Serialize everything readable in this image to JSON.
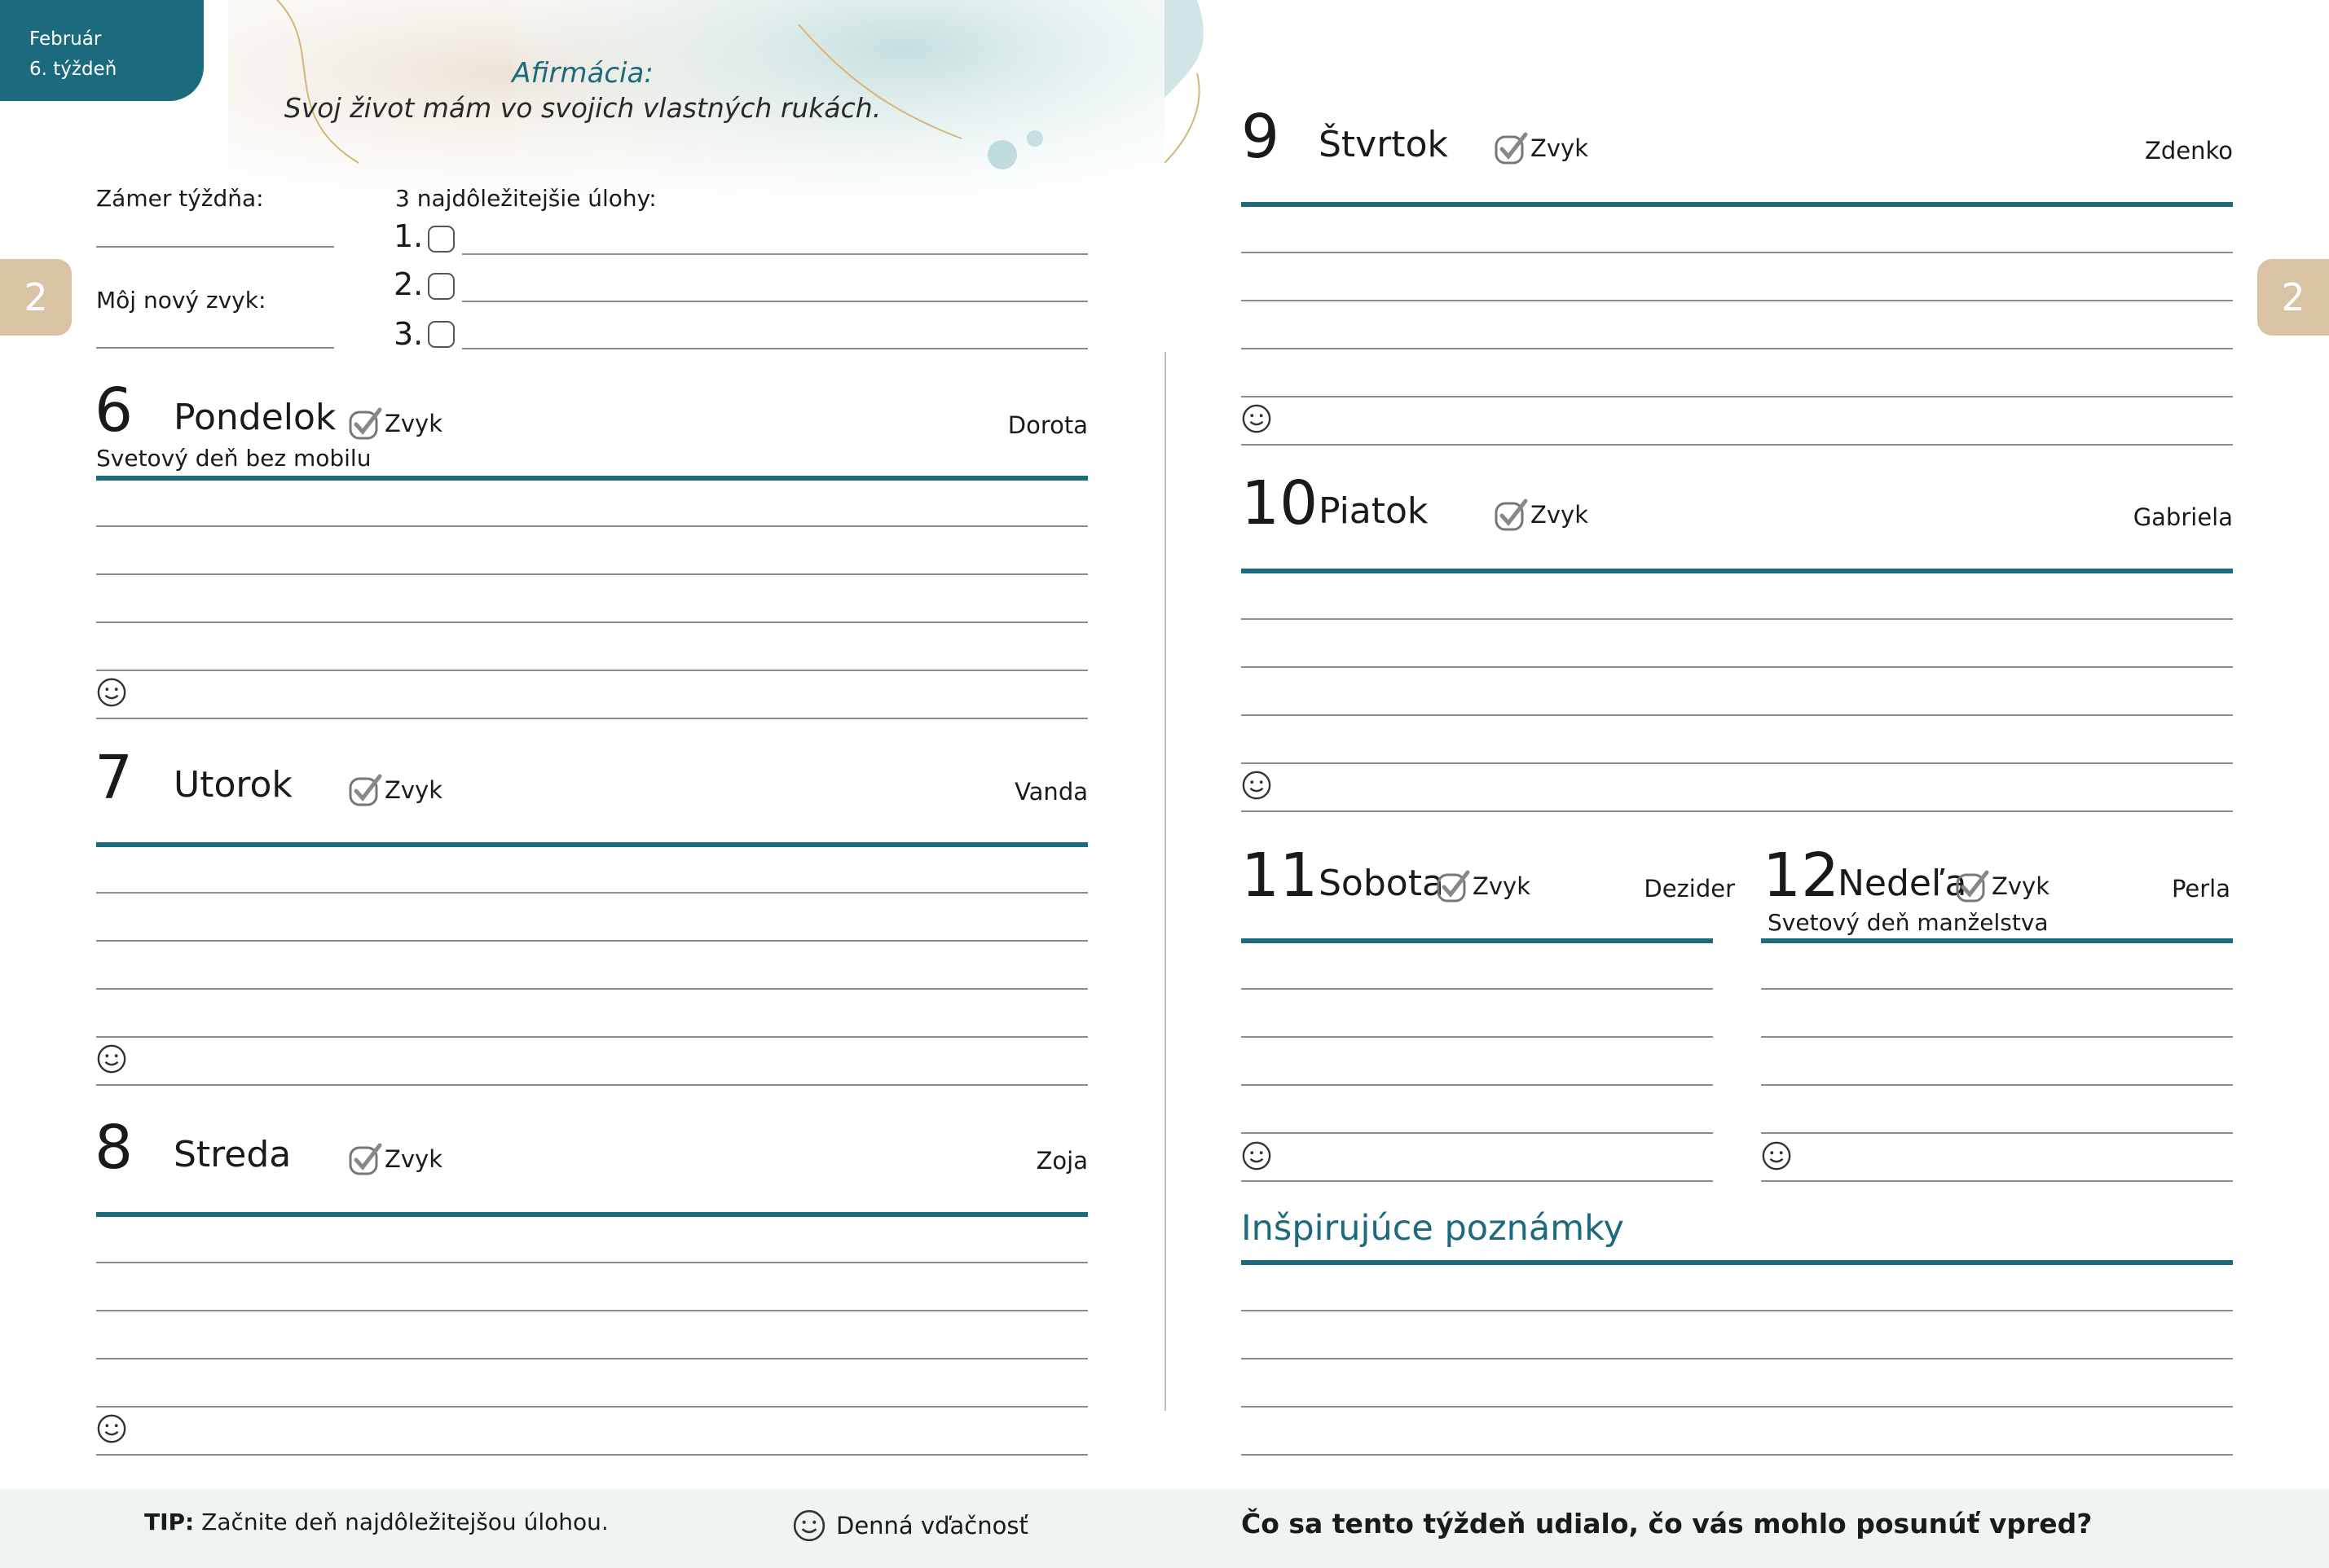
{
  "header": {
    "month": "Február",
    "week": "6. týždeň",
    "tab_number": "2"
  },
  "affirmation": {
    "title": "Afirmácia:",
    "text": "Svoj život mám vo svojich vlastných rukách."
  },
  "planning": {
    "intent_label": "Zámer týždňa:",
    "habit_label": "Môj nový zvyk:",
    "tasks_label": "3 najdôležitejšie úlohy:",
    "task_numbers": [
      "1.",
      "2.",
      "3."
    ]
  },
  "habit_label": "Zvyk",
  "days": [
    {
      "num": "6",
      "name": "Pondelok",
      "nameday": "Dorota",
      "event": "Svetový deň bez mobilu"
    },
    {
      "num": "7",
      "name": "Utorok",
      "nameday": "Vanda",
      "event": ""
    },
    {
      "num": "8",
      "name": "Streda",
      "nameday": "Zoja",
      "event": ""
    },
    {
      "num": "9",
      "name": "Štvrtok",
      "nameday": "Zdenko",
      "event": ""
    },
    {
      "num": "10",
      "name": "Piatok",
      "nameday": "Gabriela",
      "event": ""
    },
    {
      "num": "11",
      "name": "Sobota",
      "nameday": "Dezider",
      "event": ""
    },
    {
      "num": "12",
      "name": "Nedeľa",
      "nameday": "Perla",
      "event": "Svetový deň manželstva"
    }
  ],
  "notes_title": "Inšpirujúce poznámky",
  "footer": {
    "tip_label": "TIP:",
    "tip_text": " Začnite deň najdôležitejšou úlohou.",
    "gratitude": "Denná vďačnosť",
    "question": "Čo sa tento týždeň udialo, čo vás mohlo posunúť vpred?"
  },
  "colors": {
    "accent": "#1b6a7e",
    "tab": "#d9c3a5",
    "rule": "#8c8c8c"
  },
  "icons": [
    "checkbox-icon",
    "habit-check-icon",
    "smiley-icon"
  ]
}
